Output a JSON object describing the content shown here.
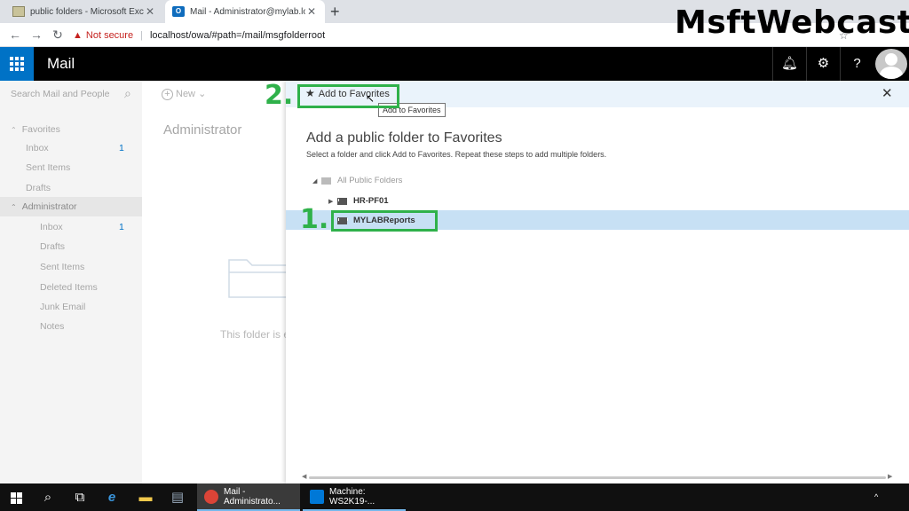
{
  "browser": {
    "tabs": [
      {
        "title": "public folders - Microsoft Exchan",
        "icon": "public-folder-icon"
      },
      {
        "title": "Mail - Administrator@mylab.loca",
        "icon": "outlook-icon"
      }
    ],
    "security_label": "Not secure",
    "separator": "|",
    "url": "localhost/owa/#path=/mail/msgfolderroot"
  },
  "watermark": "MsftWebcast",
  "owa": {
    "app_title": "Mail",
    "search_placeholder": "Search Mail and People",
    "new_label": "New",
    "favorites_label": "Favorites",
    "favorites": [
      {
        "label": "Inbox",
        "count": "1"
      },
      {
        "label": "Sent Items",
        "count": ""
      },
      {
        "label": "Drafts",
        "count": ""
      }
    ],
    "account_label": "Administrator",
    "account_folders": [
      {
        "label": "Inbox",
        "count": "1"
      },
      {
        "label": "Drafts",
        "count": ""
      },
      {
        "label": "Sent Items",
        "count": ""
      },
      {
        "label": "Deleted Items",
        "count": ""
      },
      {
        "label": "Junk Email",
        "count": ""
      },
      {
        "label": "Notes",
        "count": ""
      }
    ],
    "folder_title": "Administrator",
    "empty_text": "This folder is e"
  },
  "panel": {
    "add_favorites_label": "Add to Favorites",
    "tooltip": "Add to Favorites",
    "heading": "Add a public folder to Favorites",
    "instructions": "Select a folder and click Add to Favorites. Repeat these steps to add multiple folders.",
    "tree": {
      "root": "All Public Folders",
      "children": [
        "HR-PF01",
        "MYLABReports"
      ]
    }
  },
  "annotations": {
    "step1": "1.",
    "step2": "2."
  },
  "taskbar": {
    "apps": [
      {
        "label": "Mail - Administrato...",
        "color": "#db4437"
      },
      {
        "label": "Machine: WS2K19-...",
        "color": "#0078d7"
      }
    ],
    "tray": "^"
  },
  "colors": {
    "accent": "#0072c6",
    "annotation": "#2fb14a",
    "selection": "#c7e0f4"
  }
}
